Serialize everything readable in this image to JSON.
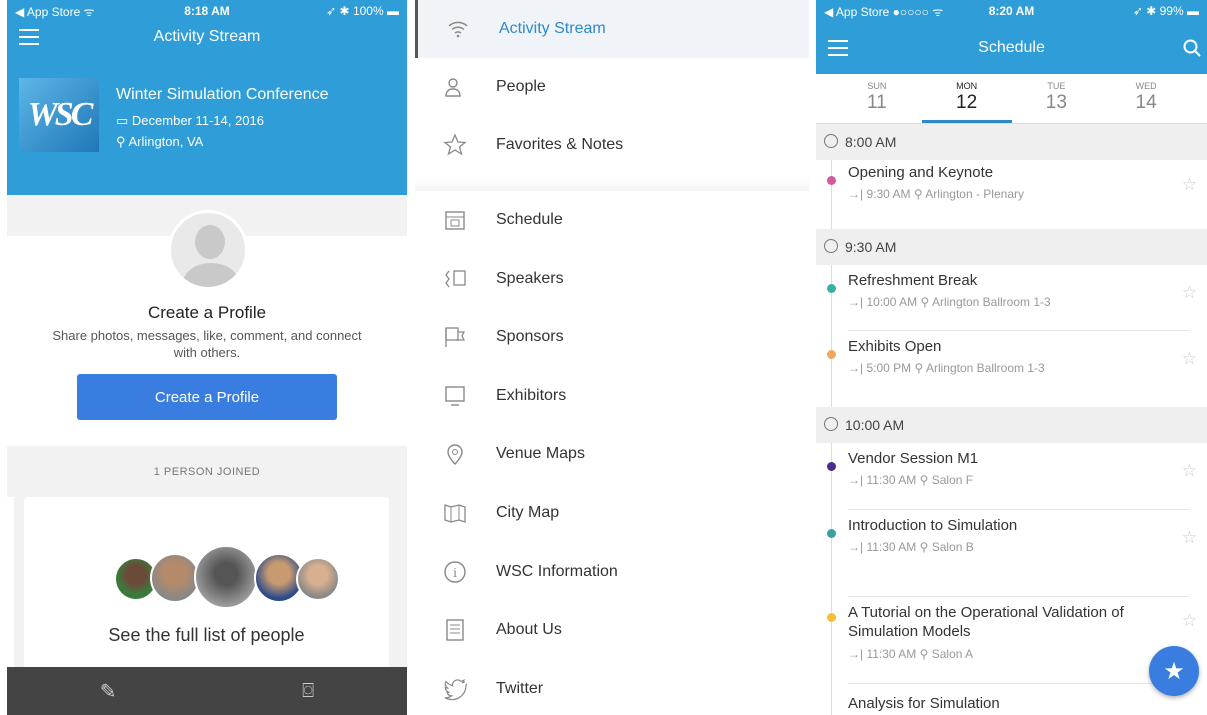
{
  "colors": {
    "accent": "#2f9ed8",
    "button": "#3a7de0",
    "link": "#2f88cc"
  },
  "left": {
    "status": {
      "carrier": "App Store",
      "time": "8:18 AM",
      "battery": "100%"
    },
    "title": "Activity Stream",
    "conference": {
      "name": "Winter Simulation Conference",
      "dates": "December 11-14, 2016",
      "location": "Arlington, VA",
      "logo_text": "WSC"
    },
    "profile": {
      "title": "Create a Profile",
      "subtitle": "Share photos, messages, like, comment, and connect with others.",
      "button": "Create a Profile"
    },
    "joined": "1 PERSON JOINED",
    "full_list": "See the full list of people",
    "tabs": [
      {
        "icon": "pencil-icon"
      },
      {
        "icon": "camera-icon"
      }
    ]
  },
  "menu": {
    "items": [
      {
        "label": "Activity Stream",
        "icon": "wifi-icon",
        "active": true
      },
      {
        "label": "People",
        "icon": "people-icon"
      },
      {
        "label": "Favorites & Notes",
        "icon": "star-icon"
      },
      {
        "label": "Schedule",
        "icon": "calendar-icon"
      },
      {
        "label": "Speakers",
        "icon": "speaker-icon"
      },
      {
        "label": "Sponsors",
        "icon": "flag-icon"
      },
      {
        "label": "Exhibitors",
        "icon": "monitor-icon"
      },
      {
        "label": "Venue Maps",
        "icon": "location-icon"
      },
      {
        "label": "City Map",
        "icon": "map-icon"
      },
      {
        "label": "WSC Information",
        "icon": "info-icon"
      },
      {
        "label": "About Us",
        "icon": "document-icon"
      },
      {
        "label": "Twitter",
        "icon": "twitter-icon"
      }
    ]
  },
  "right": {
    "status": {
      "carrier": "App Store",
      "time": "8:20 AM",
      "battery": "99%"
    },
    "title": "Schedule",
    "days": [
      {
        "name": "SUN",
        "num": "11"
      },
      {
        "name": "MON",
        "num": "12",
        "selected": true
      },
      {
        "name": "TUE",
        "num": "13"
      },
      {
        "name": "WED",
        "num": "14"
      }
    ],
    "slots": [
      {
        "time": "8:00 AM",
        "events": [
          {
            "title": "Opening and Keynote",
            "end": "9:30 AM",
            "room": "Arlington - Plenary",
            "color": "#d45a9a"
          }
        ]
      },
      {
        "time": "9:30 AM",
        "events": [
          {
            "title": "Refreshment Break",
            "end": "10:00 AM",
            "room": "Arlington Ballroom 1-3",
            "color": "#38b0a4"
          },
          {
            "title": "Exhibits Open",
            "end": "5:00 PM",
            "room": "Arlington Ballroom 1-3",
            "color": "#f0a95a"
          }
        ]
      },
      {
        "time": "10:00 AM",
        "events": [
          {
            "title": "Vendor Session M1",
            "end": "11:30 AM",
            "room": "Salon F",
            "color": "#4a2d8a"
          },
          {
            "title": "Introduction to Simulation",
            "end": "11:30 AM",
            "room": "Salon B",
            "color": "#38a0a4"
          },
          {
            "title": "A Tutorial on the Operational Validation of Simulation Models",
            "end": "11:30 AM",
            "room": "Salon A",
            "color": "#f0c23a"
          },
          {
            "title": "Analysis for Simulation"
          }
        ]
      }
    ]
  }
}
